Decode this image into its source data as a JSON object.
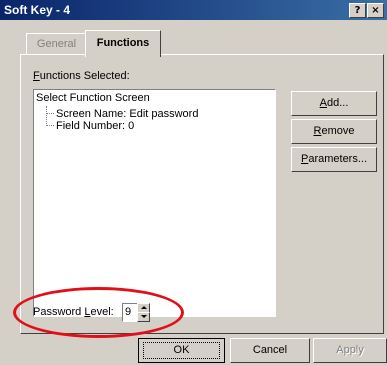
{
  "window": {
    "title": "Soft Key - 4",
    "help_button": "?",
    "close_button": "×"
  },
  "tabs": [
    {
      "label": "General",
      "active": false
    },
    {
      "label": "Functions",
      "active": true
    }
  ],
  "functions_label_first": "F",
  "functions_label_rest": "unctions Selected:",
  "tree": {
    "root": "Select Function Screen",
    "children": [
      "Screen Name:  Edit password",
      "Field Number:  0"
    ]
  },
  "side_buttons": {
    "add_first": "A",
    "add_rest": "dd...",
    "remove_first": "R",
    "remove_rest": "emove",
    "parameters_first": "P",
    "parameters_rest": "arameters..."
  },
  "password": {
    "label_before": "Password ",
    "label_key": "L",
    "label_after": "evel:",
    "value": "9"
  },
  "dialog_buttons": {
    "ok": "OK",
    "cancel": "Cancel",
    "apply": "Apply"
  },
  "colors": {
    "title_bar": "#0a246a",
    "face": "#d4d0c8",
    "highlight_ellipse": "#e0101a"
  }
}
